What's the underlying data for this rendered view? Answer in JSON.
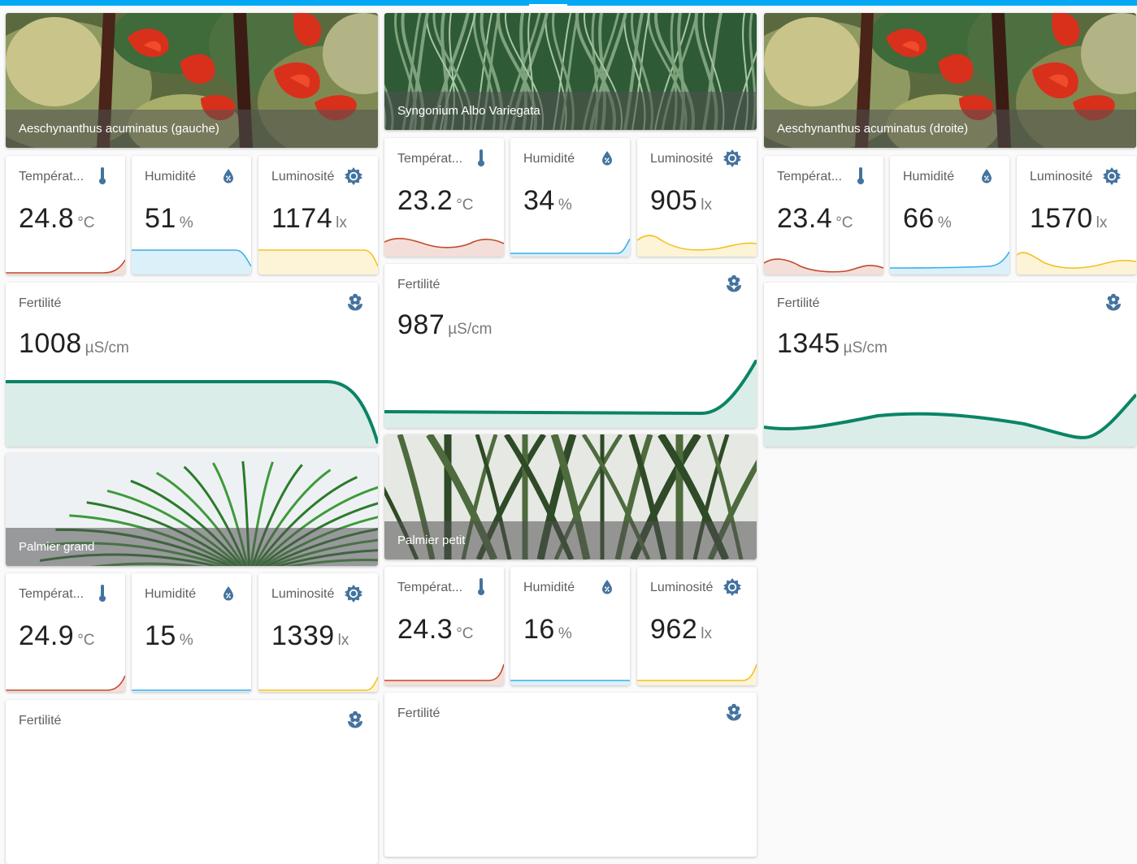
{
  "colors": {
    "accent": "#03a9f4",
    "icon": "#44739e",
    "temperature": "#c1492b",
    "humidity": "#3bade6",
    "luminosity": "#f5c020",
    "fertility": "#0b8466"
  },
  "labels": {
    "temperature": "Températ...",
    "humidity": "Humidité",
    "luminosity": "Luminosité",
    "fertility": "Fertilité"
  },
  "units": {
    "temperature": "°C",
    "humidity": "%",
    "luminosity": "lx",
    "fertility": "µS/cm"
  },
  "icons": {
    "temperature": "thermometer-icon",
    "humidity": "water-percent-icon",
    "luminosity": "sun-icon",
    "fertility": "flower-icon"
  },
  "plants": [
    {
      "name": "Aeschynanthus acuminatus (gauche)",
      "image": "red-flower-photo",
      "temperature": "24.8",
      "humidity": "51",
      "luminosity": "1174",
      "fertility": "1008"
    },
    {
      "name": "Syngonium Albo Variegata",
      "image": "green-stems-photo",
      "temperature": "23.2",
      "humidity": "34",
      "luminosity": "905",
      "fertility": "987"
    },
    {
      "name": "Aeschynanthus acuminatus (droite)",
      "image": "red-flower-photo",
      "temperature": "23.4",
      "humidity": "66",
      "luminosity": "1570",
      "fertility": "1345"
    },
    {
      "name": "Palmier grand",
      "image": "palm-photo",
      "temperature": "24.9",
      "humidity": "15",
      "luminosity": "1339"
    },
    {
      "name": "Palmier petit",
      "image": "small-palm-photo",
      "temperature": "24.3",
      "humidity": "16",
      "luminosity": "962"
    }
  ]
}
